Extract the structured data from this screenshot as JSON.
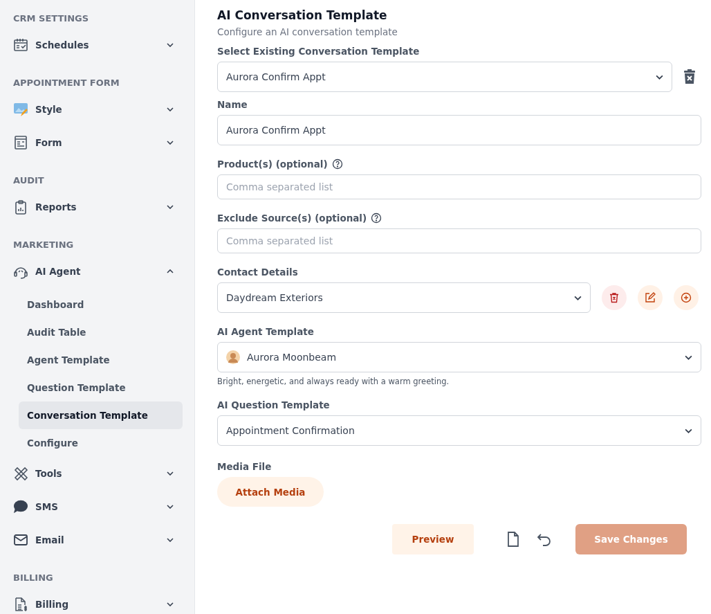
{
  "sidebar": {
    "sections": [
      {
        "heading": "CRM SETTINGS",
        "items": [
          {
            "label": "Schedules",
            "expanded": false
          }
        ]
      },
      {
        "heading": "APPOINTMENT FORM",
        "items": [
          {
            "label": "Style",
            "expanded": false
          },
          {
            "label": "Form",
            "expanded": false
          }
        ]
      },
      {
        "heading": "AUDIT",
        "items": [
          {
            "label": "Reports",
            "expanded": false
          }
        ]
      },
      {
        "heading": "MARKETING",
        "items": [
          {
            "label": "AI Agent",
            "expanded": true,
            "children": [
              {
                "label": "Dashboard",
                "selected": false
              },
              {
                "label": "Audit Table",
                "selected": false
              },
              {
                "label": "Agent Template",
                "selected": false
              },
              {
                "label": "Question Template",
                "selected": false
              },
              {
                "label": "Conversation Template",
                "selected": true
              },
              {
                "label": "Configure",
                "selected": false
              }
            ]
          },
          {
            "label": "Tools",
            "expanded": false
          },
          {
            "label": "SMS",
            "expanded": false
          },
          {
            "label": "Email",
            "expanded": false
          }
        ]
      },
      {
        "heading": "BILLING",
        "items": [
          {
            "label": "Billing",
            "expanded": false
          }
        ]
      }
    ]
  },
  "form": {
    "title": "AI Conversation Template",
    "subtitle": "Configure an AI conversation template",
    "fields": [
      {
        "kind": "template-select",
        "label": "Select Existing Conversation Template",
        "value": "Aurora Confirm Appt"
      },
      {
        "kind": "text",
        "label": "Name",
        "value": "Aurora Confirm Appt"
      },
      {
        "kind": "optional-text",
        "label": "Product(s) (optional)",
        "placeholder": "Comma separated list"
      },
      {
        "kind": "optional-text",
        "label": "Exclude Source(s) (optional)",
        "placeholder": "Comma separated list"
      },
      {
        "kind": "contact-select",
        "label": "Contact Details",
        "value": "Daydream Exteriors"
      },
      {
        "kind": "agent-select",
        "label": "AI Agent Template",
        "value": "Aurora Moonbeam",
        "note": "Bright, energetic, and always ready with a warm greeting."
      },
      {
        "kind": "select",
        "label": "AI Question Template",
        "value": "Appointment Confirmation"
      },
      {
        "kind": "media",
        "label": "Media File",
        "button": "Attach Media"
      }
    ]
  },
  "footer": {
    "preview": "Preview",
    "save": {
      "label": "Save Changes",
      "disabled": true
    }
  }
}
